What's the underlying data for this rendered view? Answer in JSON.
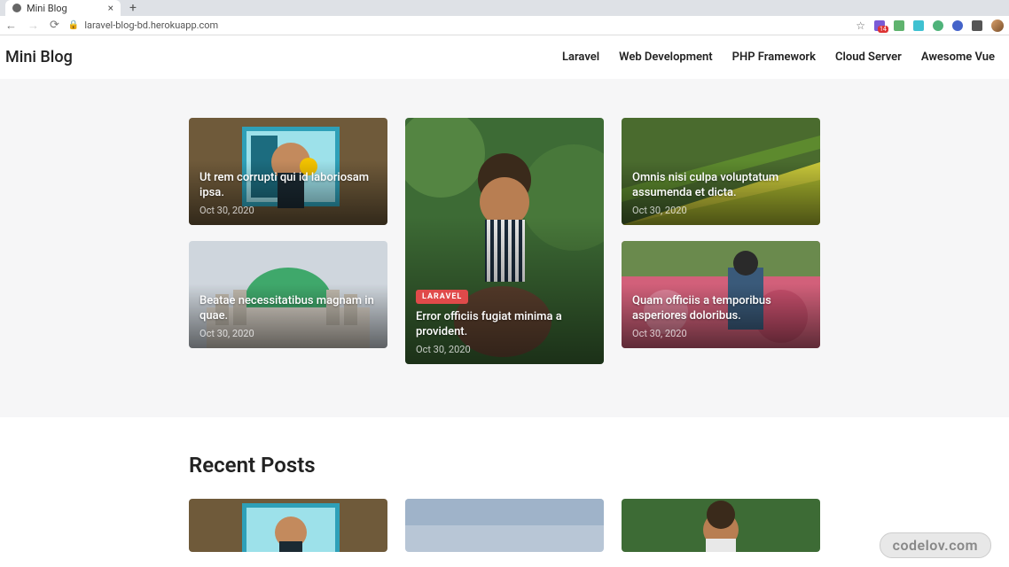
{
  "browser": {
    "tab_title": "Mini Blog",
    "url": "laravel-blog-bd.herokuapp.com",
    "ext_colors": [
      "#7a5bd6",
      "#5fb36e",
      "#3fc1d1",
      "#4fb37a",
      "#4463c9",
      "#444"
    ],
    "ext_badge": "14"
  },
  "site": {
    "title": "Mini Blog",
    "nav": [
      "Laravel",
      "Web Development",
      "PHP Framework",
      "Cloud Server",
      "Awesome Vue"
    ]
  },
  "hero": {
    "col_a": [
      {
        "title": "Ut rem corrupti qui id laboriosam ipsa.",
        "date": "Oct 30, 2020"
      },
      {
        "title": "Beatae necessitatibus magnam in quae.",
        "date": "Oct 30, 2020"
      }
    ],
    "col_b": {
      "badge": "LARAVEL",
      "title": "Error officiis fugiat minima a provident.",
      "date": "Oct 30, 2020"
    },
    "col_c": [
      {
        "title": "Omnis nisi culpa voluptatum assumenda et dicta.",
        "date": "Oct 30, 2020"
      },
      {
        "title": "Quam officiis a temporibus asperiores doloribus.",
        "date": "Oct 30, 2020"
      }
    ]
  },
  "recent": {
    "heading": "Recent Posts"
  },
  "watermark": "codelov.com"
}
